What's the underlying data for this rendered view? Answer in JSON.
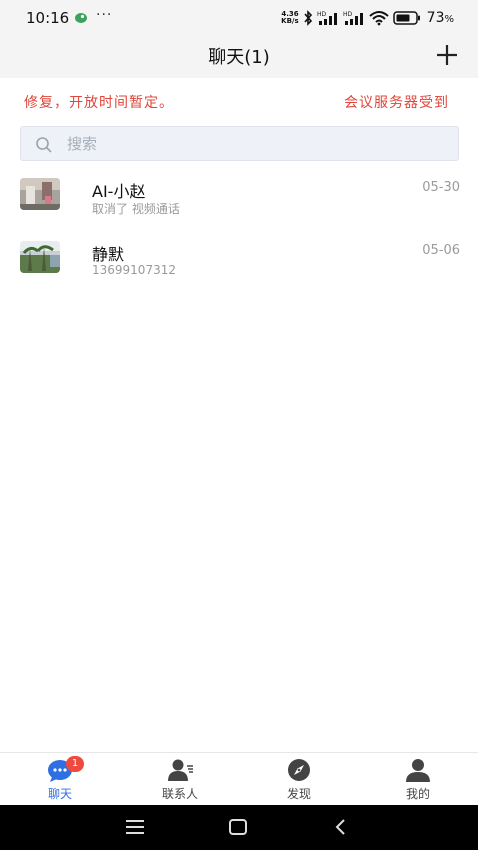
{
  "status_bar": {
    "time": "10:16",
    "more_dots": "···",
    "net_speed_value": "4.36",
    "net_speed_unit": "KB/s",
    "battery_percent": "73"
  },
  "header": {
    "title": "聊天(1)"
  },
  "notice": {
    "left_text": "修复，开放时间暂定。",
    "right_text": "会议服务器受到"
  },
  "search": {
    "placeholder": "搜索"
  },
  "conversations": [
    {
      "name": "AI-小赵",
      "subtitle": "取消了 视频通话",
      "date": "05-30"
    },
    {
      "name": "静默",
      "subtitle": "13699107312",
      "date": "05-06"
    }
  ],
  "tabs": [
    {
      "label": "聊天",
      "badge": "1",
      "active": true
    },
    {
      "label": "联系人"
    },
    {
      "label": "发现"
    },
    {
      "label": "我的"
    }
  ],
  "colors": {
    "accent": "#2f6fe4",
    "notice_red": "#e0463a",
    "badge_red": "#f04a3e"
  }
}
